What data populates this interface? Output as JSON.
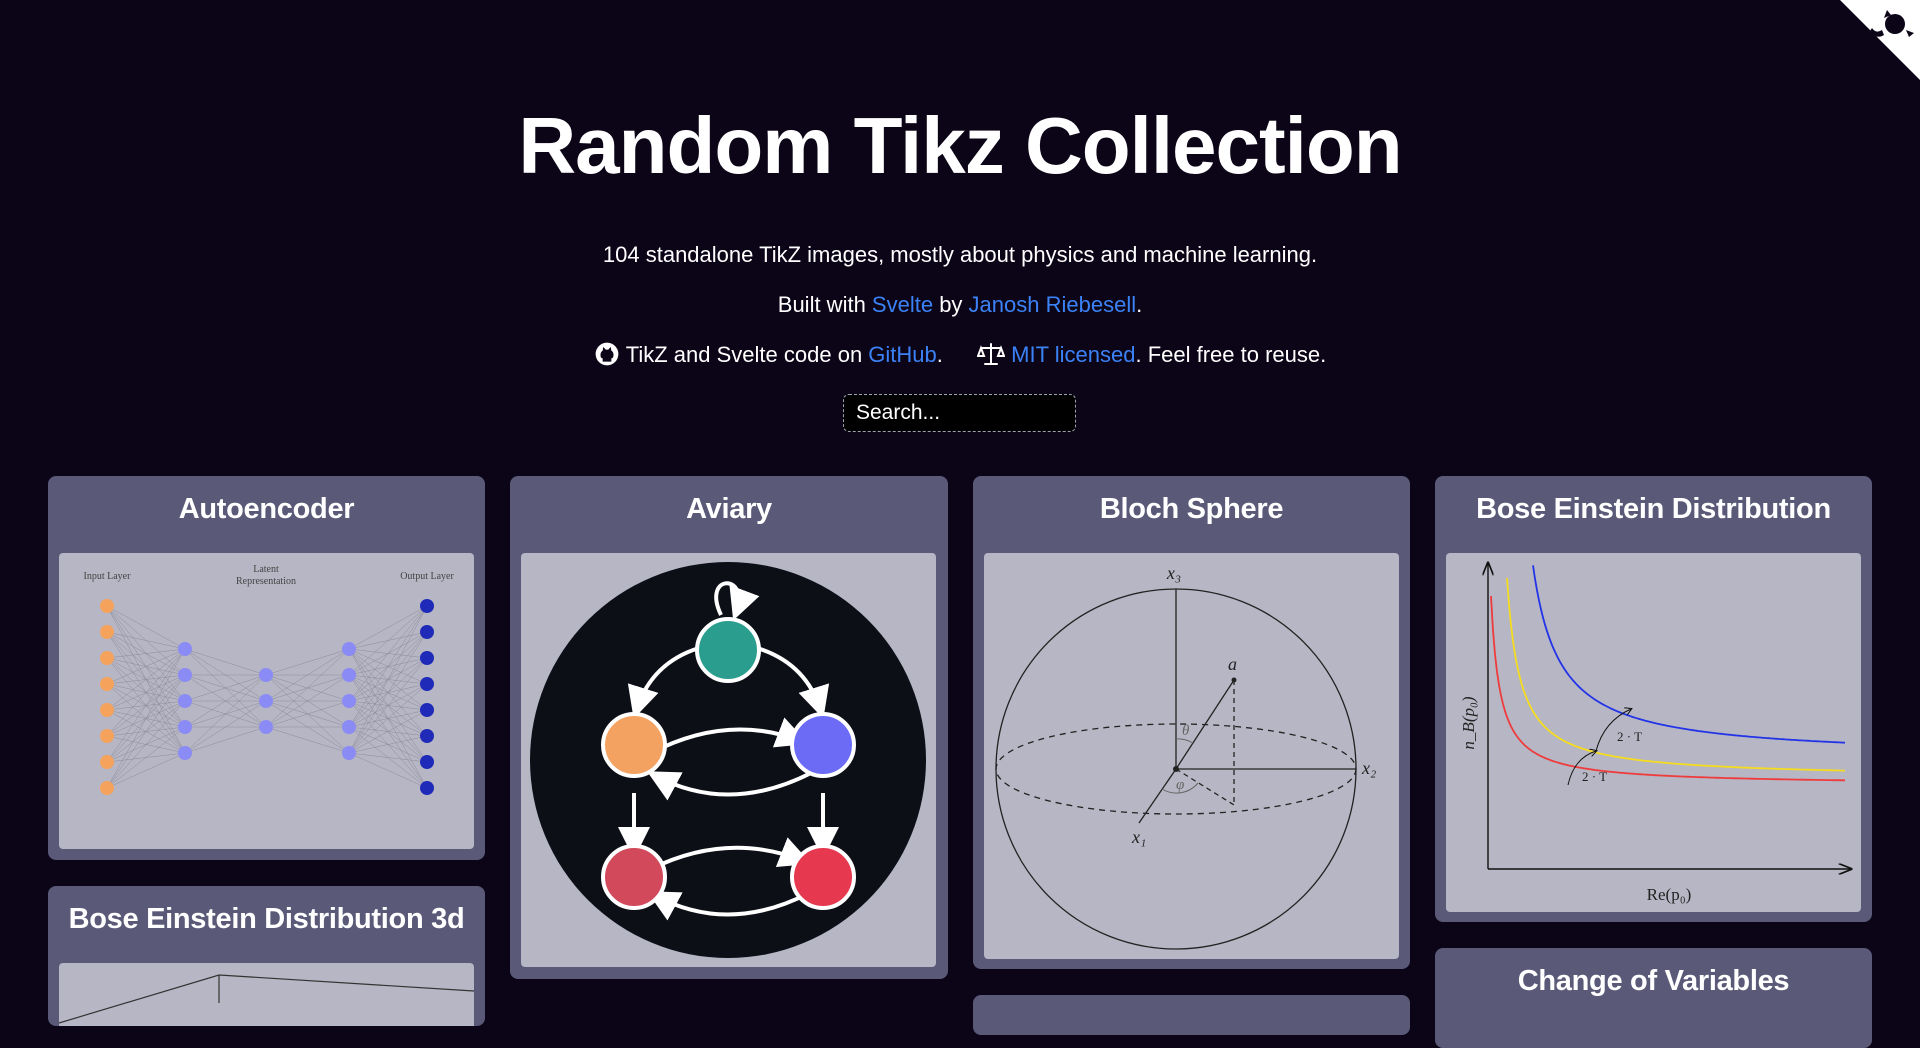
{
  "header": {
    "title": "Random Tikz Collection",
    "subtitle": "104 standalone TikZ images, mostly about physics and machine learning.",
    "built_with_prefix": "Built with ",
    "built_with_link": "Svelte",
    "built_by_mid": " by ",
    "author_link": "Janosh Riebesell",
    "built_suffix": ".",
    "code_prefix": "TikZ and Svelte code on ",
    "code_link": "GitHub",
    "code_suffix": ".",
    "license_link": "MIT licensed",
    "license_suffix": ". Feel free to reuse."
  },
  "search": {
    "placeholder": "Search..."
  },
  "cards": [
    {
      "title": "Autoencoder"
    },
    {
      "title": "Aviary"
    },
    {
      "title": "Bloch Sphere"
    },
    {
      "title": "Bose Einstein Distribution"
    },
    {
      "title": "Bose Einstein Distribution 3d"
    },
    {
      "title": "Change of Variables"
    }
  ],
  "figures": {
    "autoencoder": {
      "input_label": "Input Layer",
      "latent_label_1": "Latent",
      "latent_label_2": "Representation",
      "output_label": "Output Layer",
      "colors": {
        "input": "#f5a25d",
        "hidden": "#8b8bf5",
        "output": "#1f2bb8"
      }
    },
    "aviary": {
      "colors": {
        "top": "#2a9d8f",
        "left": "#f4a261",
        "right": "#6b6bf5",
        "bottom_left": "#d1495b",
        "bottom_right": "#e63950"
      }
    },
    "bloch": {
      "x3": "x₃",
      "x2": "x₂",
      "x1": "x₁",
      "a": "a⃗",
      "theta": "θ",
      "phi": "φ"
    },
    "bose": {
      "ylabel": "n_B(p₀)",
      "xlabel": "Re(p₀)",
      "anno1": "2 · T",
      "anno2": "2 · T",
      "colors": {
        "red": "#ef3b3b",
        "yellow": "#f5dc1e",
        "blue": "#2233e8"
      }
    }
  },
  "colors": {
    "background": "#0c0518",
    "card": "#5a5a78",
    "image_bg": "#b6b6c4",
    "link": "#3b82f6"
  }
}
